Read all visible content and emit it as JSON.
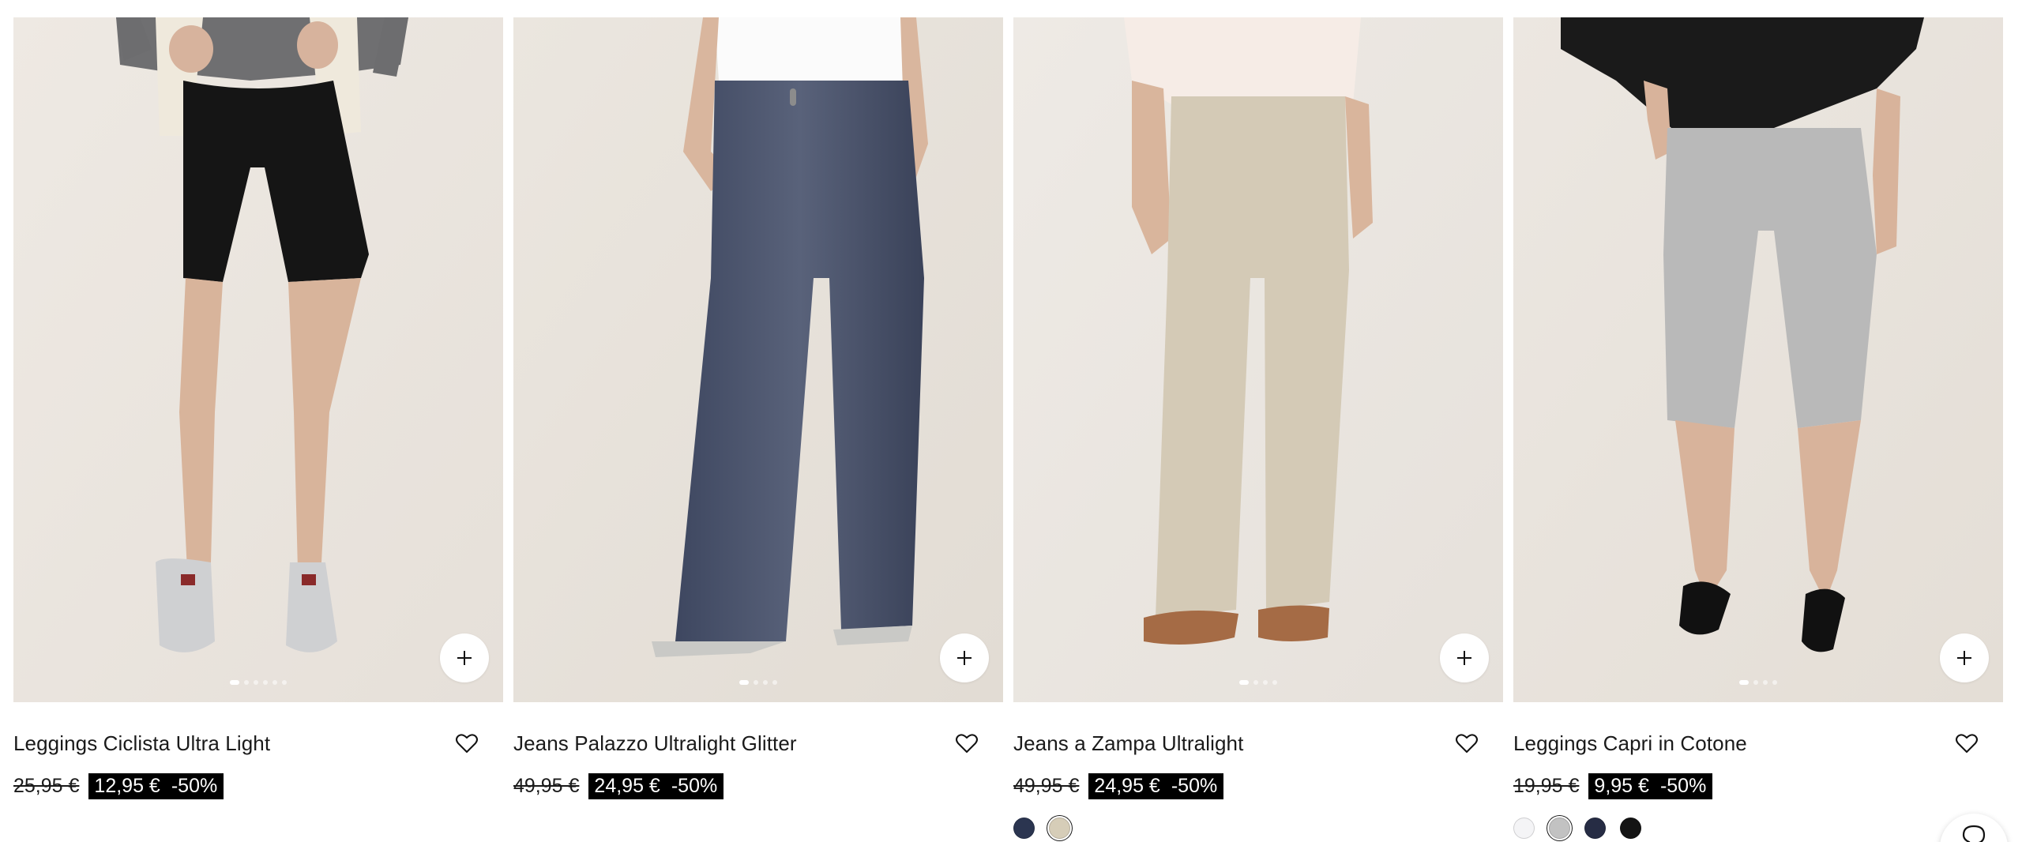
{
  "products": [
    {
      "name": "Leggings Ciclista Ultra Light",
      "old_price": "25,95 €",
      "sale_price": "12,95 €",
      "discount": "-50%",
      "image_dots": 6,
      "swatches": []
    },
    {
      "name": "Jeans Palazzo Ultralight Glitter",
      "old_price": "49,95 €",
      "sale_price": "24,95 €",
      "discount": "-50%",
      "image_dots": 4,
      "swatches": []
    },
    {
      "name": "Jeans a Zampa Ultralight",
      "old_price": "49,95 €",
      "sale_price": "24,95 €",
      "discount": "-50%",
      "image_dots": 4,
      "swatches": [
        {
          "color": "#2b3550",
          "selected": false
        },
        {
          "color": "#d6cdb8",
          "selected": true
        }
      ]
    },
    {
      "name": "Leggings Capri in Cotone",
      "old_price": "19,95 €",
      "sale_price": "9,95 €",
      "discount": "-50%",
      "image_dots": 4,
      "swatches": [
        {
          "color": "#f4f4f6",
          "selected": false
        },
        {
          "color": "#c2c2c2",
          "selected": true
        },
        {
          "color": "#262c44",
          "selected": false
        },
        {
          "color": "#141414",
          "selected": false
        }
      ]
    }
  ],
  "icons": {
    "add": "plus-icon",
    "favorite": "heart-icon",
    "chat": "chat-icon"
  },
  "colors": {
    "sale_badge_bg": "#000000",
    "sale_badge_text": "#ffffff",
    "photo_bg": "#ece7e1"
  }
}
